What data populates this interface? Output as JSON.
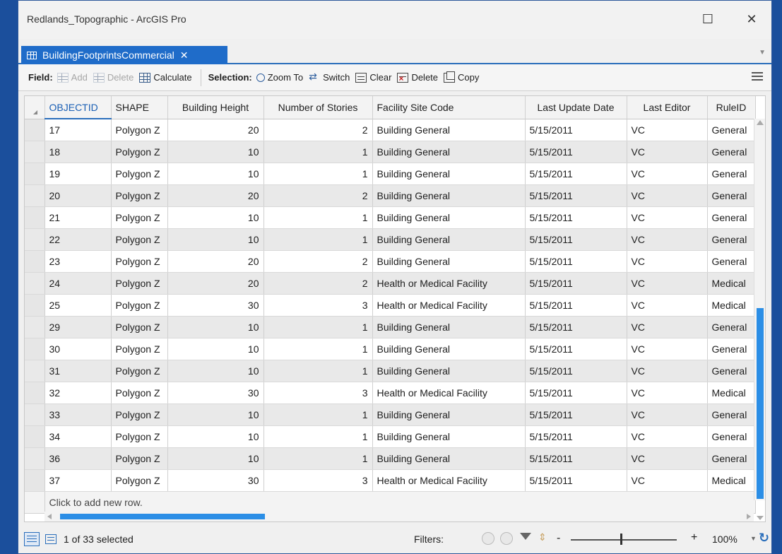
{
  "window": {
    "title": "Redlands_Topographic - ArcGIS Pro",
    "maximize_glyph": "☐",
    "close_glyph": "✕"
  },
  "tab": {
    "label": "BuildingFootprintsCommercial",
    "close_glyph": "✕"
  },
  "toolbar": {
    "field_label": "Field:",
    "add_label": "Add",
    "delete_field_label": "Delete",
    "calculate_label": "Calculate",
    "selection_label": "Selection:",
    "zoom_to_label": "Zoom To",
    "switch_label": "Switch",
    "clear_label": "Clear",
    "delete_selection_label": "Delete",
    "copy_label": "Copy"
  },
  "table": {
    "columns": [
      "OBJECTID",
      "SHAPE",
      "Building Height",
      "Number of Stories",
      "Facility Site Code",
      "Last Update Date",
      "Last Editor",
      "RuleID"
    ],
    "rows": [
      [
        "17",
        "Polygon Z",
        "20",
        "2",
        "Building General",
        "5/15/2011",
        "VC",
        "General"
      ],
      [
        "18",
        "Polygon Z",
        "10",
        "1",
        "Building General",
        "5/15/2011",
        "VC",
        "General"
      ],
      [
        "19",
        "Polygon Z",
        "10",
        "1",
        "Building General",
        "5/15/2011",
        "VC",
        "General"
      ],
      [
        "20",
        "Polygon Z",
        "20",
        "2",
        "Building General",
        "5/15/2011",
        "VC",
        "General"
      ],
      [
        "21",
        "Polygon Z",
        "10",
        "1",
        "Building General",
        "5/15/2011",
        "VC",
        "General"
      ],
      [
        "22",
        "Polygon Z",
        "10",
        "1",
        "Building General",
        "5/15/2011",
        "VC",
        "General"
      ],
      [
        "23",
        "Polygon Z",
        "20",
        "2",
        "Building General",
        "5/15/2011",
        "VC",
        "General"
      ],
      [
        "24",
        "Polygon Z",
        "20",
        "2",
        "Health or Medical Facility",
        "5/15/2011",
        "VC",
        "Medical"
      ],
      [
        "25",
        "Polygon Z",
        "30",
        "3",
        "Health or Medical Facility",
        "5/15/2011",
        "VC",
        "Medical"
      ],
      [
        "29",
        "Polygon Z",
        "10",
        "1",
        "Building General",
        "5/15/2011",
        "VC",
        "General"
      ],
      [
        "30",
        "Polygon Z",
        "10",
        "1",
        "Building General",
        "5/15/2011",
        "VC",
        "General"
      ],
      [
        "31",
        "Polygon Z",
        "10",
        "1",
        "Building General",
        "5/15/2011",
        "VC",
        "General"
      ],
      [
        "32",
        "Polygon Z",
        "30",
        "3",
        "Health or Medical Facility",
        "5/15/2011",
        "VC",
        "Medical"
      ],
      [
        "33",
        "Polygon Z",
        "10",
        "1",
        "Building General",
        "5/15/2011",
        "VC",
        "General"
      ],
      [
        "34",
        "Polygon Z",
        "10",
        "1",
        "Building General",
        "5/15/2011",
        "VC",
        "General"
      ],
      [
        "36",
        "Polygon Z",
        "10",
        "1",
        "Building General",
        "5/15/2011",
        "VC",
        "General"
      ],
      [
        "37",
        "Polygon Z",
        "30",
        "3",
        "Health or Medical Facility",
        "5/15/2011",
        "VC",
        "Medical"
      ]
    ],
    "add_row_text": "Click to add new row."
  },
  "status": {
    "selection_text": "1 of 33 selected",
    "filters_label": "Filters:",
    "zoom_minus": "-",
    "zoom_plus": "+",
    "zoom_value": "100%",
    "zoom_level": 100
  },
  "colors": {
    "accent": "#1f6cc9",
    "desktop": "#1b4f9c",
    "scrollbar": "#2b8ee6"
  },
  "icons": {
    "table_tab": "table-icon",
    "add_field": "add-field-icon",
    "delete_field": "delete-field-icon",
    "calculate": "calculate-icon",
    "zoom_to": "zoom-to-icon",
    "switch": "switch-icon",
    "clear": "clear-icon",
    "delete_selection": "delete-selection-icon",
    "copy": "copy-icon",
    "menu": "hamburger-menu-icon",
    "refresh": "refresh-icon"
  }
}
